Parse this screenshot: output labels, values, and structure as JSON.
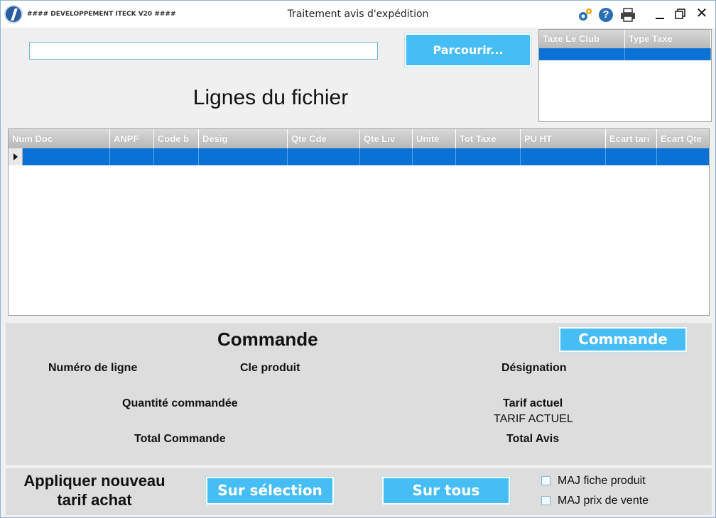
{
  "window": {
    "app_name": "#### DEVELOPPEMENT ITECK V20 ####",
    "title": "Traitement avis d'expédition"
  },
  "file": {
    "path_value": "",
    "browse_label": "Parcourir..."
  },
  "heading": "Lignes du fichier",
  "tax_grid": {
    "columns": [
      "Taxe Le Club",
      "Type Taxe"
    ]
  },
  "main_grid": {
    "columns": [
      "Num Doc",
      "ANPF",
      "Code b",
      "Désig",
      "Qte Cde",
      "Qte Liv",
      "Unité",
      "Tot Taxe",
      "PU HT",
      "Ecart tari",
      "Ecart Qte"
    ]
  },
  "commande": {
    "title": "Commande",
    "button_label": "Commande",
    "numero_ligne": "Numéro de ligne",
    "cle_produit": "Cle produit",
    "designation": "Désignation",
    "quantite_commandee": "Quantité commandée",
    "tarif_actuel": "Tarif actuel",
    "tarif_actuel_value": "TARIF ACTUEL",
    "total_commande": "Total Commande",
    "total_avis": "Total Avis"
  },
  "apply": {
    "title_line1": "Appliquer nouveau",
    "title_line2": "tarif achat",
    "selection_label": "Sur sélection",
    "all_label": "Sur tous",
    "maj_fiche": "MAJ fiche produit",
    "maj_prix": "MAJ prix de vente"
  },
  "colors": {
    "accent": "#46bdf5",
    "selection": "#0a72d6"
  }
}
